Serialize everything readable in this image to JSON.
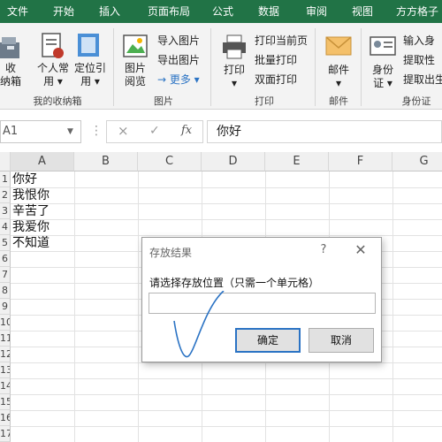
{
  "tabs": [
    "文件",
    "开始",
    "插入",
    "页面布局",
    "公式",
    "数据",
    "审阅",
    "视图",
    "方方格子"
  ],
  "ribbon": {
    "collect": {
      "label": "收\n纳箱",
      "group": "我的收纳箱"
    },
    "personal": {
      "label": "个人常\n用 ▾"
    },
    "locate": {
      "label": "定位引\n用 ▾"
    },
    "image_browse": {
      "label": "图片\n阅览"
    },
    "import_image": "导入图片",
    "export_image": "导出图片",
    "more": "→ 更多 ▾",
    "image_group": "图片",
    "print": {
      "label": "打印\n▾"
    },
    "print_current": "打印当前页",
    "batch_print": "批量打印",
    "duplex_print": "双面打印",
    "print_group": "打印",
    "mail": {
      "label": "邮件\n▾"
    },
    "mail_group": "邮件",
    "id_card": {
      "label": "身份\n证 ▾"
    },
    "input_id": "输入身",
    "extract_gender": "提取性",
    "extract_birth": "提取出生",
    "id_group": "身份证"
  },
  "formula_bar": {
    "name_box": "A1",
    "cancel_icon": "×",
    "enter_icon": "✓",
    "fx_label": "fx",
    "content": "你好"
  },
  "columns": [
    "A",
    "B",
    "C",
    "D",
    "E",
    "F",
    "G"
  ],
  "rows": [
    "1",
    "2",
    "3",
    "4",
    "5",
    "6",
    "7",
    "8",
    "9",
    "10",
    "11",
    "12",
    "13",
    "14",
    "15",
    "16",
    "17"
  ],
  "cells": [
    "你好",
    "我恨你",
    "辛苦了",
    "我爱你",
    "不知道"
  ],
  "dialog": {
    "title": "存放结果",
    "help": "?",
    "close": "✕",
    "prompt": "请选择存放位置（只需一个单元格）",
    "input_value": "",
    "ok": "确定",
    "cancel": "取消"
  },
  "colors": {
    "ribbon_green": "#217346",
    "focus_blue": "#2b73c4"
  }
}
